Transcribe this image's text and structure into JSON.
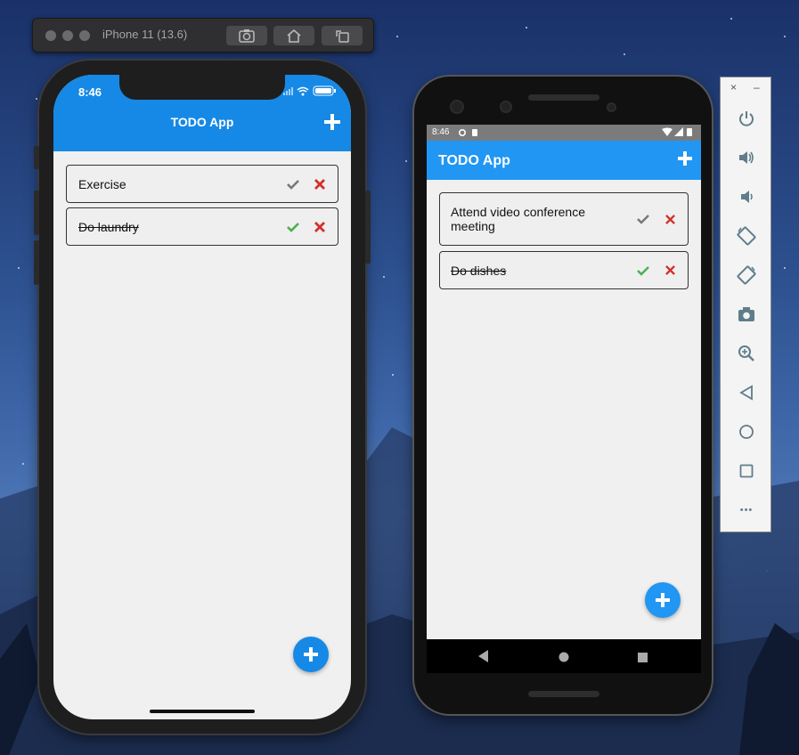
{
  "simulator": {
    "title": "iPhone 11 (13.6)"
  },
  "ios_app": {
    "status_time": "8:46",
    "title": "TODO App",
    "todos": [
      {
        "text": "Exercise",
        "done": false
      },
      {
        "text": "Do laundry",
        "done": true
      }
    ]
  },
  "android_app": {
    "status_time": "8:46",
    "title": "TODO App",
    "todos": [
      {
        "text": "Attend video conference meeting",
        "done": false
      },
      {
        "text": "Do dishes",
        "done": true
      }
    ]
  },
  "emulator_panel": {
    "close_glyph": "×",
    "minimize_glyph": "–",
    "more_glyph": "•••"
  },
  "colors": {
    "ios_primary": "#1689e6",
    "android_primary": "#2196f3",
    "done_check": "#4caf50",
    "pending_check": "#777777",
    "delete": "#d32f2f"
  },
  "icons": [
    "camera-icon",
    "home-icon",
    "rotate-icon",
    "plus-icon",
    "check-icon",
    "delete-icon",
    "power-icon",
    "volume-up-icon",
    "volume-down-icon",
    "zoom-icon",
    "back-icon",
    "home-circle-icon",
    "overview-icon",
    "more-icon"
  ]
}
